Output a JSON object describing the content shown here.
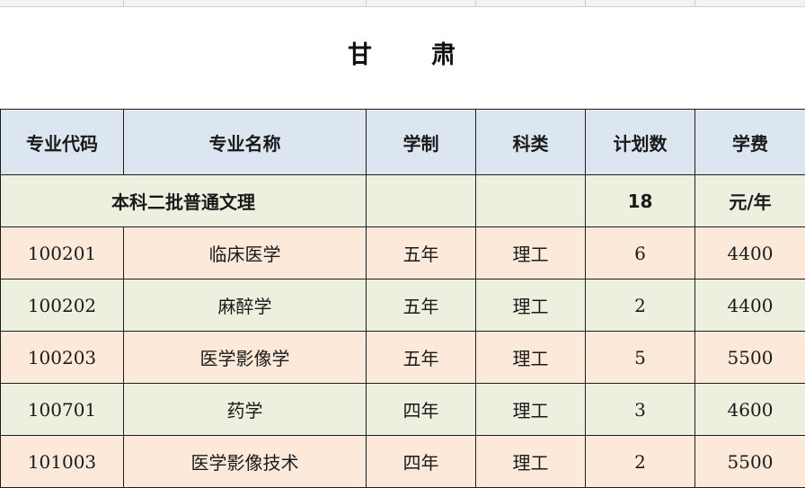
{
  "sheet": {
    "title_left": "甘",
    "title_right": "肃"
  },
  "table": {
    "headers": [
      "专业代码",
      "专业名称",
      "学制",
      "科类",
      "计划数",
      "学费"
    ],
    "group_row": {
      "label": "本科二批普通文理",
      "plan_total": "18",
      "fee_unit": "元/年"
    },
    "rows": [
      {
        "code": "100201",
        "name": "临床医学",
        "years": "五年",
        "category": "理工",
        "plan": "6",
        "fee": "4400"
      },
      {
        "code": "100202",
        "name": "麻醉学",
        "years": "五年",
        "category": "理工",
        "plan": "2",
        "fee": "4400"
      },
      {
        "code": "100203",
        "name": "医学影像学",
        "years": "五年",
        "category": "理工",
        "plan": "5",
        "fee": "5500"
      },
      {
        "code": "100701",
        "name": "药学",
        "years": "四年",
        "category": "理工",
        "plan": "3",
        "fee": "4600"
      },
      {
        "code": "101003",
        "name": "医学影像技术",
        "years": "四年",
        "category": "理工",
        "plan": "2",
        "fee": "5500"
      }
    ]
  },
  "colors": {
    "header_bg": "#dce6f1",
    "green_bg": "#ebf1de",
    "peach_bg": "#fde9d9",
    "border": "#1e1e1e"
  }
}
